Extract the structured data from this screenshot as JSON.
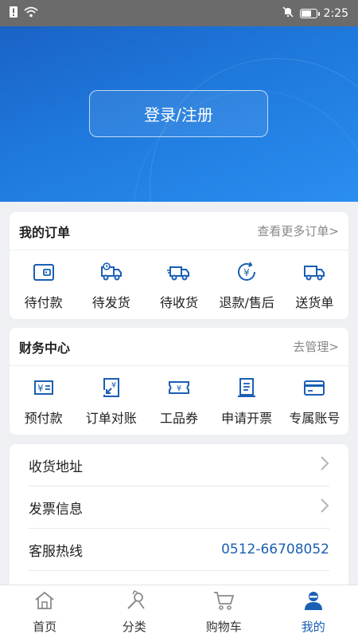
{
  "status_bar": {
    "time": "2:25"
  },
  "hero": {
    "login_label": "登录/注册"
  },
  "orders": {
    "title": "我的订单",
    "more": "查看更多订单>",
    "items": [
      {
        "label": "待付款",
        "icon": "wallet-icon"
      },
      {
        "label": "待发货",
        "icon": "delivery-truck-icon"
      },
      {
        "label": "待收货",
        "icon": "truck-icon"
      },
      {
        "label": "退款/售后",
        "icon": "refund-icon"
      },
      {
        "label": "送货单",
        "icon": "truck-outline-icon"
      }
    ]
  },
  "finance": {
    "title": "财务中心",
    "more": "去管理>",
    "items": [
      {
        "label": "预付款",
        "icon": "prepay-icon"
      },
      {
        "label": "订单对账",
        "icon": "reconcile-icon"
      },
      {
        "label": "工品券",
        "icon": "coupon-icon"
      },
      {
        "label": "申请开票",
        "icon": "invoice-icon"
      },
      {
        "label": "专属账号",
        "icon": "card-icon"
      }
    ]
  },
  "settings": {
    "address": "收货地址",
    "invoice": "发票信息",
    "hotline_label": "客服热线",
    "hotline_number": "0512-66708052"
  },
  "tabbar": {
    "home": "首页",
    "category": "分类",
    "cart": "购物车",
    "mine": "我的"
  },
  "colors": {
    "accent": "#1a5fb4",
    "hero": "#1f79dc"
  }
}
